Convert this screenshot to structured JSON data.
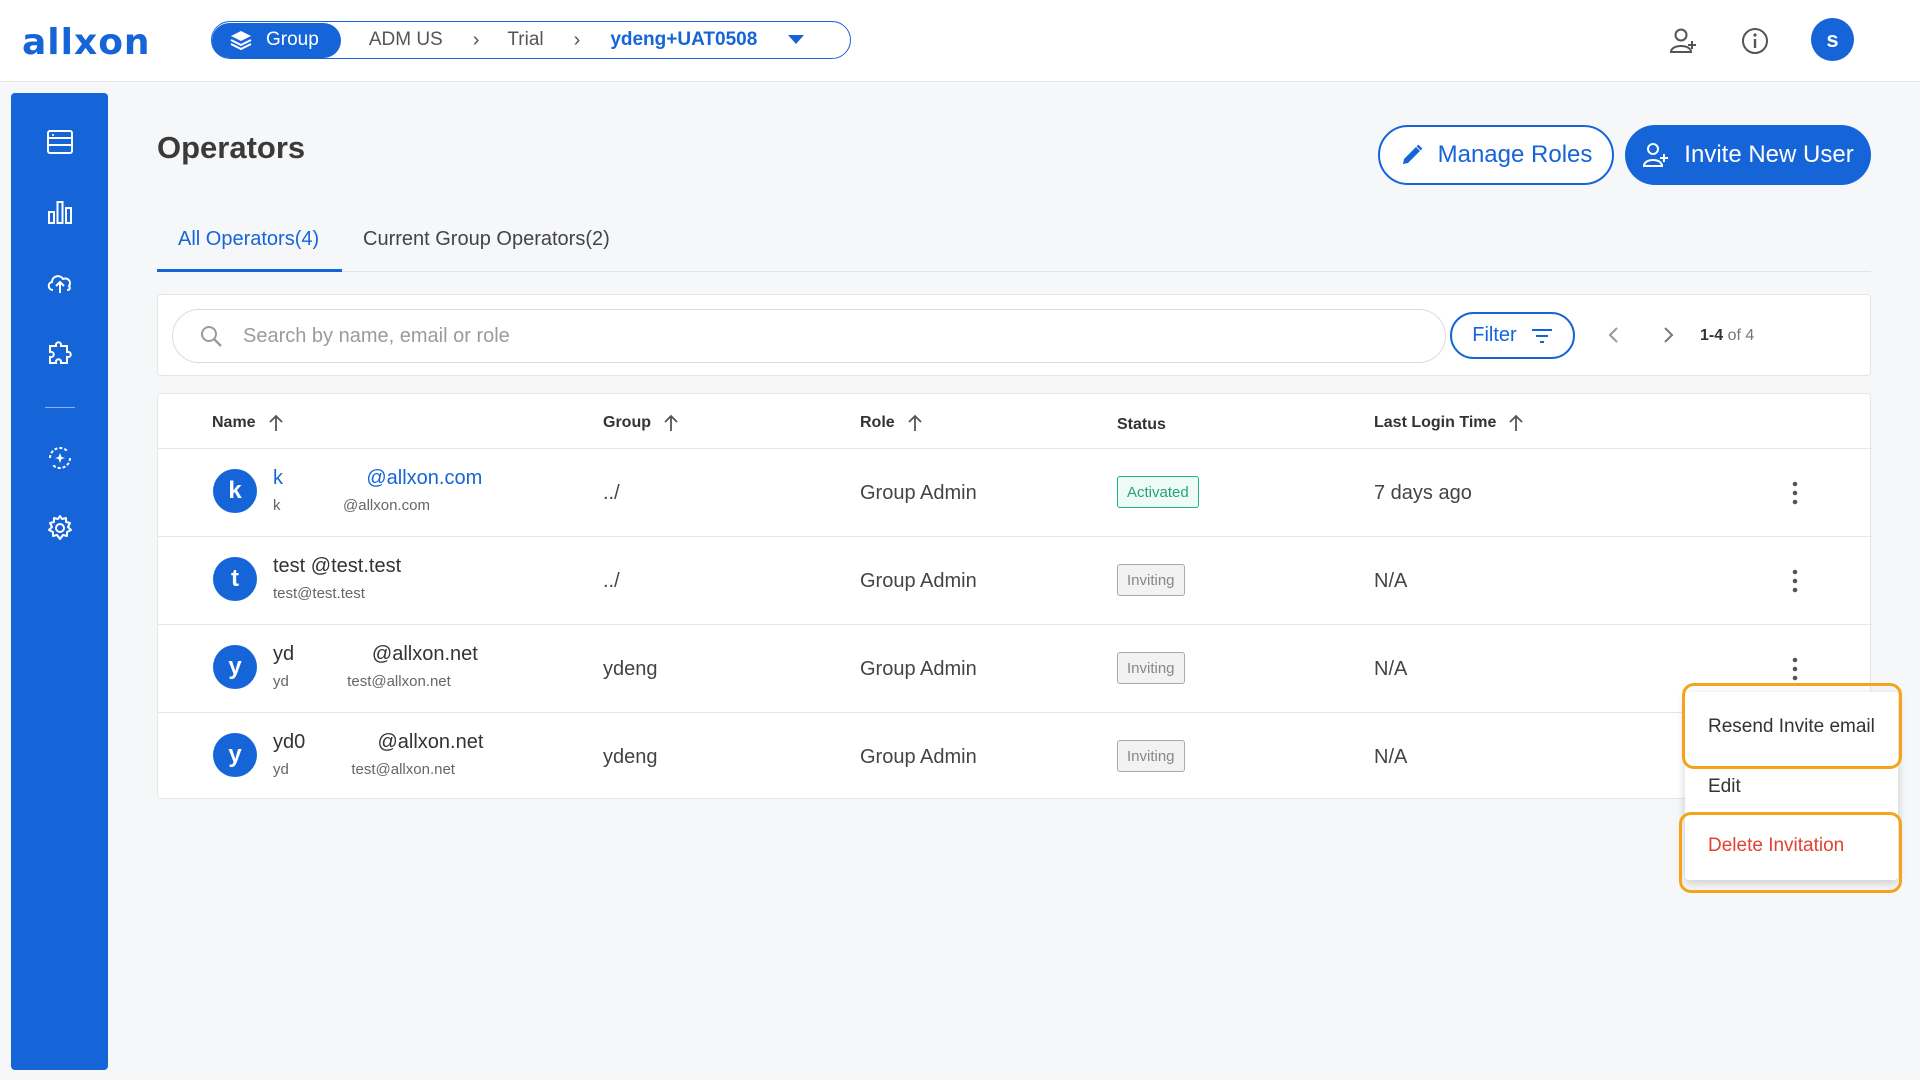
{
  "brand": {
    "logo_text": "allxon"
  },
  "breadcrumb": {
    "group_label": "Group",
    "items": [
      "ADM US",
      "Trial"
    ],
    "current": "ydeng+UAT0508"
  },
  "page": {
    "title": "Operators"
  },
  "actions": {
    "manage_roles": "Manage Roles",
    "invite_user": "Invite New User"
  },
  "tabs": [
    {
      "label": "All Operators(4)",
      "active": true
    },
    {
      "label": "Current Group Operators(2)",
      "active": false
    }
  ],
  "search": {
    "placeholder": "Search by name, email or role",
    "value": ""
  },
  "filter": {
    "label": "Filter"
  },
  "pager": {
    "range": "1-4",
    "of_text": "of 4"
  },
  "table": {
    "columns": [
      "Name",
      "Group",
      "Role",
      "Status",
      "Last Login Time"
    ],
    "rows": [
      {
        "initial": "k",
        "name": "k               @allxon.com",
        "sub": "k               @allxon.com",
        "group": "../",
        "role": "Group Admin",
        "status": "Activated",
        "last_login": "7 days ago"
      },
      {
        "initial": "t",
        "name": "test @test.test",
        "sub": "test@test.test",
        "group": "../",
        "role": "Group Admin",
        "status": "Inviting",
        "last_login": "N/A"
      },
      {
        "initial": "y",
        "name": "yd              @allxon.net",
        "sub": "yd              test@allxon.net",
        "group": "ydeng",
        "role": "Group Admin",
        "status": "Inviting",
        "last_login": "N/A"
      },
      {
        "initial": "y",
        "name": "yd0             @allxon.net",
        "sub": "yd               test@allxon.net",
        "group": "ydeng",
        "role": "Group Admin",
        "status": "Inviting",
        "last_login": "N/A"
      }
    ]
  },
  "context_menu": {
    "items": [
      "Resend Invite email",
      "Edit",
      "Delete Invitation"
    ]
  },
  "user": {
    "avatar_initial": "s"
  },
  "colors": {
    "primary": "#1565d8",
    "danger": "#e0432f",
    "highlight": "#f5a31a",
    "success": "#20b28a"
  }
}
